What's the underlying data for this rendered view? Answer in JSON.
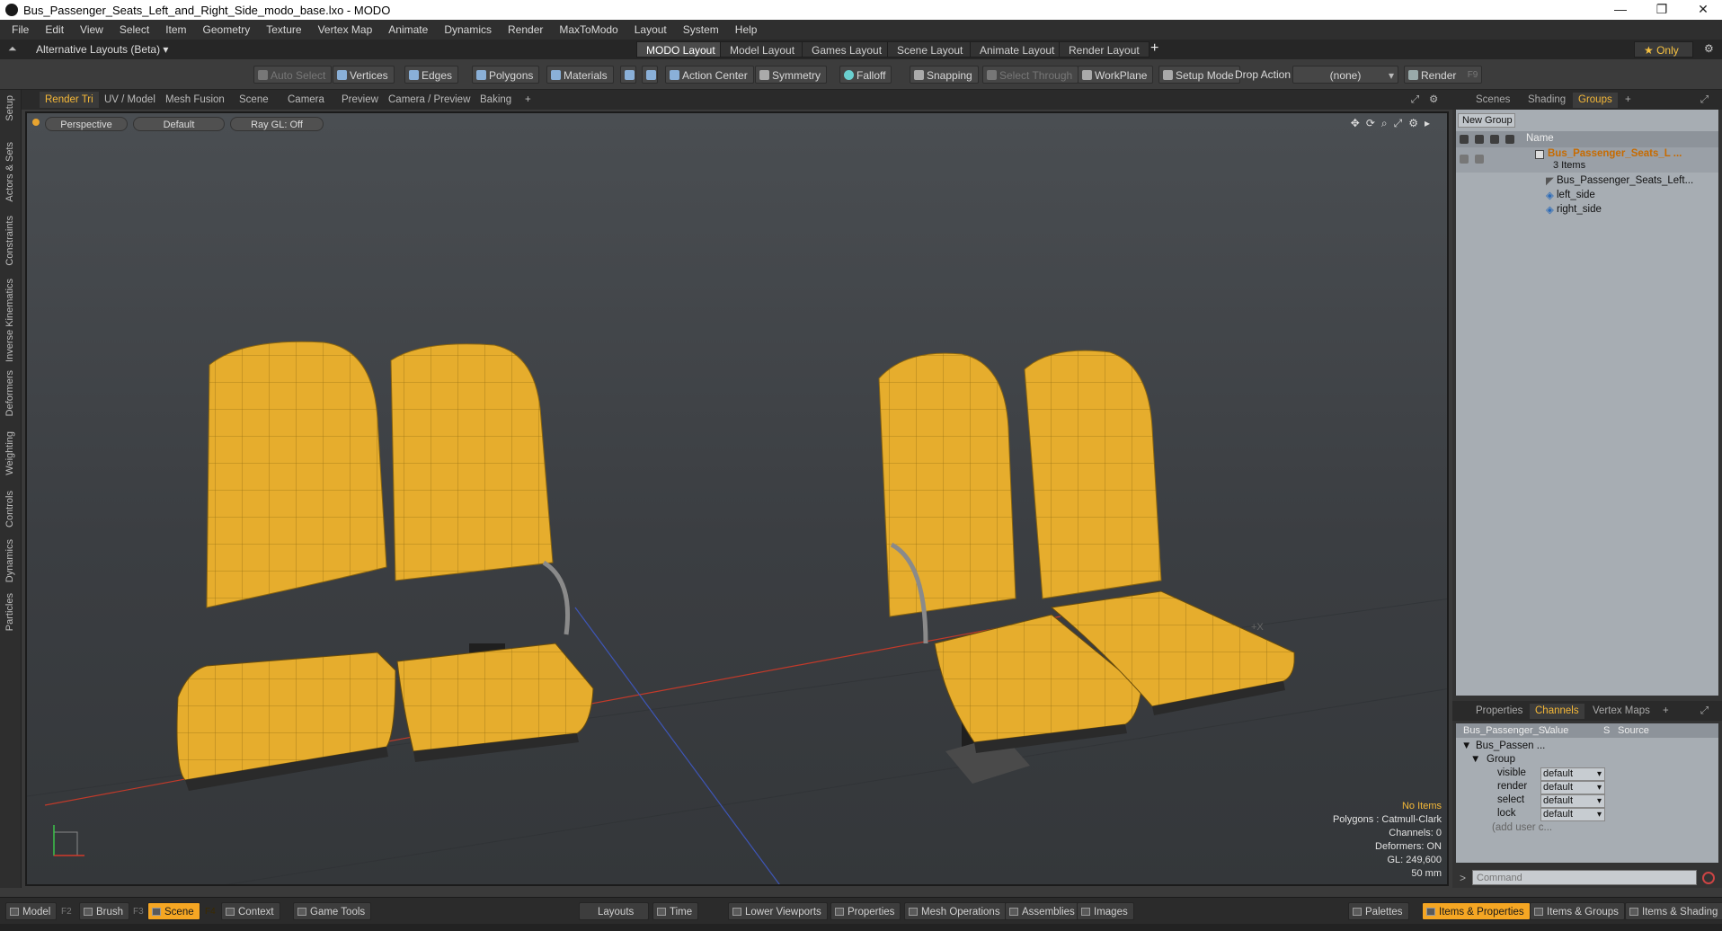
{
  "window": {
    "title": "Bus_Passenger_Seats_Left_and_Right_Side_modo_base.lxo - MODO",
    "minimize": "—",
    "restore": "❐",
    "close": "✕"
  },
  "menu": [
    "File",
    "Edit",
    "View",
    "Select",
    "Item",
    "Geometry",
    "Texture",
    "Vertex Map",
    "Animate",
    "Dynamics",
    "Render",
    "MaxToModo",
    "Layout",
    "System",
    "Help"
  ],
  "layoutbar": {
    "alt_layouts": "Alternative Layouts (Beta) ▾",
    "tabs": [
      "MODO Layout",
      "Model Layout",
      "Games Layout",
      "Scene Layout",
      "Animate Layout",
      "Render Layout"
    ],
    "active_tab": "MODO Layout",
    "add": "+",
    "only": "★ Only"
  },
  "toolbar": {
    "auto_select": "Auto Select",
    "vertices": "Vertices",
    "edges": "Edges",
    "polygons": "Polygons",
    "materials": "Materials",
    "action_center": "Action Center",
    "symmetry": "Symmetry",
    "falloff": "Falloff",
    "snapping": "Snapping",
    "select_through": "Select Through",
    "workplane": "WorkPlane",
    "setup_mode": "Setup Mode",
    "drop_action": "Drop Action",
    "drop_value": "(none)",
    "render": "Render",
    "render_key": "F9"
  },
  "left_tabs": [
    "Setup",
    "Actors & Sets",
    "Constraints",
    "Inverse Kinematics",
    "Deformers",
    "Weighting",
    "Controls",
    "Dynamics",
    "Particles"
  ],
  "viewport_tabs": [
    "Render Tri",
    "UV / Model",
    "Mesh Fusion",
    "Scene",
    "Camera",
    "Preview",
    "Camera / Preview",
    "Baking"
  ],
  "viewport": {
    "view": "Perspective",
    "shading": "Default",
    "raygl": "Ray GL: Off",
    "axis_marker": "+X"
  },
  "info": {
    "selection": "No Items",
    "polygons": "Polygons : Catmull-Clark",
    "channels": "Channels: 0",
    "deformers": "Deformers: ON",
    "gl": "GL: 249,600",
    "scale": "50 mm"
  },
  "scene_tabs": [
    "Scenes",
    "Shading",
    "Groups"
  ],
  "groups": {
    "new_group": "New Group",
    "col_name": "Name",
    "root": "Bus_Passenger_Seats_L ...",
    "count": "3 Items",
    "children": [
      "Bus_Passenger_Seats_Left...",
      "left_side",
      "right_side"
    ]
  },
  "props_tabs": [
    "Properties",
    "Channels",
    "Vertex Maps"
  ],
  "channels": {
    "header_name": "Bus_Passenger_S...",
    "col_value": "Value",
    "col_s": "S",
    "col_source": "Source",
    "item": "Bus_Passen ...",
    "group": "Group",
    "rows": [
      {
        "name": "visible",
        "value": "default"
      },
      {
        "name": "render",
        "value": "default"
      },
      {
        "name": "select",
        "value": "default"
      },
      {
        "name": "lock",
        "value": "default"
      }
    ],
    "add": "(add user c..."
  },
  "command": {
    "prompt": ">",
    "placeholder": "Command"
  },
  "bottom": {
    "model": "Model",
    "model_key": "F2",
    "brush": "Brush",
    "brush_key": "F3",
    "scene": "Scene",
    "scene_key": "F4",
    "context": "Context",
    "game_tools": "Game Tools",
    "layouts": "Layouts",
    "time": "Time",
    "lower_viewports": "Lower Viewports",
    "properties": "Properties",
    "mesh_ops": "Mesh Operations",
    "assemblies": "Assemblies",
    "images": "Images",
    "palettes": "Palettes",
    "items_props": "Items & Properties",
    "items_groups": "Items & Groups",
    "items_shading": "Items & Shading"
  },
  "colors": {
    "accent": "#f5a623",
    "seat": "#e8ae2c"
  }
}
